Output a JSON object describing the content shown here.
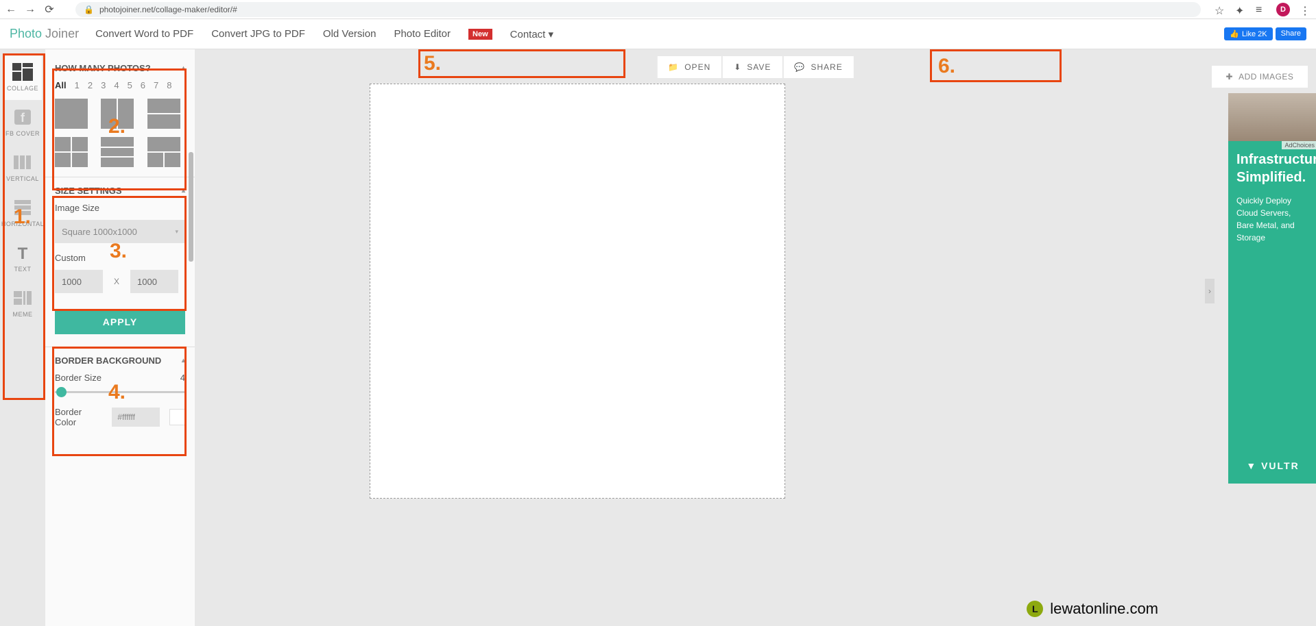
{
  "browser": {
    "url": "photojoiner.net/collage-maker/editor/#",
    "avatar_initial": "D"
  },
  "site_nav": {
    "logo_p1": "Photo ",
    "logo_p2": "Joiner",
    "links": [
      "Convert Word to PDF",
      "Convert JPG to PDF",
      "Old Version",
      "Photo Editor"
    ],
    "new_badge": "New",
    "contact": "Contact",
    "fb_like": "Like 2K",
    "fb_share": "Share"
  },
  "sidebar_tools": [
    {
      "label": "COLLAGE",
      "active": true
    },
    {
      "label": "FB COVER",
      "active": false
    },
    {
      "label": "VERTICAL",
      "active": false
    },
    {
      "label": "HORIZONTAL",
      "active": false
    },
    {
      "label": "TEXT",
      "active": false
    },
    {
      "label": "MEME",
      "active": false
    }
  ],
  "panels": {
    "how_many": {
      "title": "HOW MANY PHOTOS?",
      "filters": [
        "All",
        "1",
        "2",
        "3",
        "4",
        "5",
        "6",
        "7",
        "8"
      ],
      "active_filter": "All"
    },
    "size": {
      "title": "SIZE SETTINGS",
      "image_size_label": "Image Size",
      "preset": "Square 1000x1000",
      "custom_label": "Custom",
      "width": "1000",
      "height": "1000",
      "apply": "APPLY"
    },
    "border": {
      "title": "BORDER BACKGROUND",
      "size_label": "Border Size",
      "size_value": "4",
      "color_label": "Border Color",
      "color_value": "#ffffff"
    }
  },
  "top_actions": {
    "open": "OPEN",
    "save": "SAVE",
    "share": "SHARE"
  },
  "add_images": "ADD IMAGES",
  "ad": {
    "adchoices": "AdChoices",
    "h1": "Infrastructure",
    "h2": "Simplified.",
    "body": "Quickly Deploy Cloud Servers, Bare Metal, and Storage",
    "brand": "VULTR"
  },
  "watermark": "lewatonline.com",
  "annotations": [
    "1.",
    "2.",
    "3.",
    "4.",
    "5.",
    "6."
  ]
}
